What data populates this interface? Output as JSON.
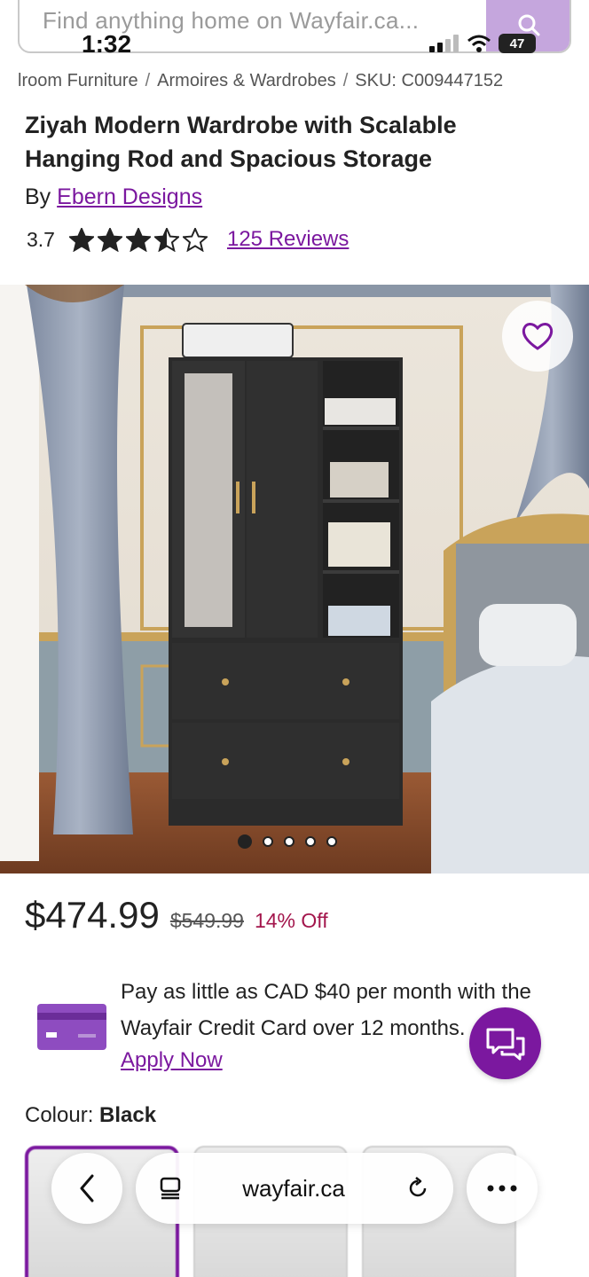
{
  "search": {
    "placeholder": "Find anything home on Wayfair.ca..."
  },
  "status": {
    "time": "1:32",
    "battery": "47"
  },
  "breadcrumb": [
    "lroom Furniture",
    "Armoires & Wardrobes",
    "SKU: C009447152"
  ],
  "product": {
    "title": "Ziyah Modern Wardrobe with Scalable Hanging Rod and Spacious Storage",
    "by_prefix": "By",
    "brand": "Ebern Designs",
    "rating": "3.7",
    "rating_value": 3.7,
    "reviews": "125 Reviews"
  },
  "gallery": {
    "active_index": 0,
    "count": 5
  },
  "price": {
    "current": "$474.99",
    "original": "$549.99",
    "discount": "14% Off"
  },
  "promo": {
    "text": "Pay as little as CAD $40 per month with the Wayfair Credit Card over 12 months.",
    "link": "Apply Now"
  },
  "colour": {
    "label": "Colour:",
    "value": "Black"
  },
  "browser": {
    "url": "wayfair.ca"
  },
  "colors": {
    "accent": "#7b189f",
    "discount": "#a3164c",
    "search_button": "#c5a6dd"
  },
  "icons": [
    "search-icon",
    "signal-icon",
    "wifi-icon",
    "battery-icon",
    "star-icon",
    "heart-icon",
    "credit-card-icon",
    "chat-icon",
    "back-icon",
    "tabs-icon",
    "reload-icon",
    "more-icon"
  ]
}
